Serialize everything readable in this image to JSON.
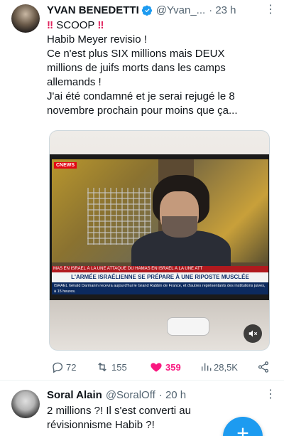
{
  "tweet": {
    "author_name": "YVAN BENEDETTI",
    "handle": "@Yvan_...",
    "time": "· 23 h",
    "lines": [
      "‼️ SCOOP ‼️",
      "Habib Meyer revisio !",
      "Ce n'est plus SIX millions mais DEUX",
      "millions de juifs morts dans les camps",
      "allemands !",
      "J'ai été condamné et je serai rejugé le 8",
      "novembre prochain pour moins que ça..."
    ],
    "scoop_label": "SCOOP",
    "media": {
      "channel_logo": "CNEWS",
      "ticker": "MAS EN ISRAEL   À LA UNE   ATTAQUE DU HAMAS EN ISRAEL   À LA UNE   ATT",
      "headline": "L'ARMÉE ISRAÉLIENNE SE PRÉPARE À UNE RIPOSTE MUSCLÉE",
      "crawl": "ISRAEL  Gérald Darmanin recevra aujourd'hui le Grand Rabbin de France, et d'autres représentants des institutions juives, à 15 heures."
    },
    "actions": {
      "replies": "72",
      "retweets": "155",
      "likes": "359",
      "views": "28,5K"
    }
  },
  "reply": {
    "author_name": "Soral Alain",
    "handle": "@SoralOff",
    "time": "· 20 h",
    "lines": [
      "2 millions ?! Il s'est converti au",
      "révisionnisme Habib ?!"
    ]
  },
  "colors": {
    "accent": "#1d9bf0",
    "like": "#f91880",
    "secondary_text": "#536471",
    "alert": "#e0245e"
  },
  "icons": {
    "verified": "verified-badge-icon",
    "more": "more-icon",
    "reply": "reply-icon",
    "retweet": "retweet-icon",
    "like": "heart-icon",
    "views": "views-icon",
    "share": "share-icon",
    "mute": "mute-icon",
    "compose": "plus-icon"
  }
}
